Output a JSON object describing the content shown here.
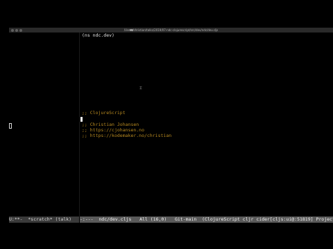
{
  "titlebar": {
    "path": "/Users/christian/talks/2019/07-ndc-clojurescript/src/dev/ndc/dev.cljs"
  },
  "editor": {
    "ns_line": "(ns ndc.dev)",
    "heading_comment": ";; ClojureScript",
    "author_comment": ";; Christian Johansen",
    "url_comment_1": ";; https://cjohansen.no",
    "url_comment_2": ";; https://kodemaker.no/christian"
  },
  "modeline_left": {
    "text": "U:**-  *scratch* (talk)"
  },
  "modeline_right": {
    "text": "-:---  ndc/dev.cljs   All (16,0)   Git-main  (ClojureScript cljr cider[cljs:ui@:51819] Project Pro"
  },
  "colors": {
    "background": "#000000",
    "comment": "#b88a20",
    "text": "#e6e6e6",
    "modeline_active": "#5a5a5a",
    "modeline_inactive": "#3a3a3a"
  }
}
